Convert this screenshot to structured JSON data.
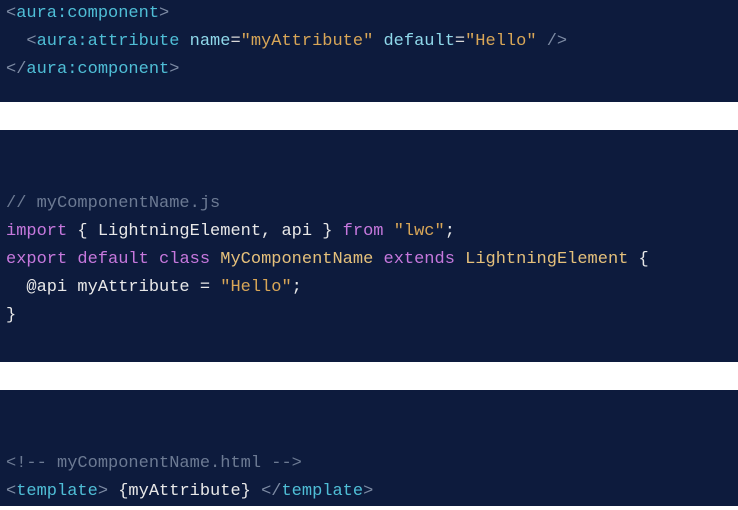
{
  "block1": {
    "l1_open": "<",
    "l1_tag": "aura:component",
    "l1_close": ">",
    "l2_indent": "  ",
    "l2_open": "<",
    "l2_tag": "aura:attribute",
    "l2_sp1": " ",
    "l2_attr1": "name",
    "l2_eq1": "=",
    "l2_val1": "\"myAttribute\"",
    "l2_sp2": " ",
    "l2_attr2": "default",
    "l2_eq2": "=",
    "l2_val2": "\"Hello\"",
    "l2_close": " />",
    "l3_open": "</",
    "l3_tag": "aura:component",
    "l3_close": ">"
  },
  "block2": {
    "l1": "// myComponentName.js",
    "l2_import": "import",
    "l2_rest1": " { LightningElement, api } ",
    "l2_from": "from",
    "l2_sp": " ",
    "l2_str": "\"lwc\"",
    "l2_semi": ";",
    "l3_export": "export",
    "l3_sp1": " ",
    "l3_default": "default",
    "l3_sp2": " ",
    "l3_class": "class",
    "l3_sp3": " ",
    "l3_name": "MyComponentName",
    "l3_sp4": " ",
    "l3_extends": "extends",
    "l3_sp5": " ",
    "l3_super": "LightningElement",
    "l3_brace": " {",
    "l4_indent": "  ",
    "l4_dec": "@api myAttribute ",
    "l4_eq": "=",
    "l4_sp": " ",
    "l4_str": "\"Hello\"",
    "l4_semi": ";",
    "l5": "}"
  },
  "block3": {
    "l1_open": "<!--",
    "l1_text": " myComponentName.html ",
    "l1_close": "-->",
    "l2_open": "<",
    "l2_tag": "template",
    "l2_close": ">",
    "l2_content": " {myAttribute} ",
    "l2_open2": "</",
    "l2_tag2": "template",
    "l2_close2": ">"
  }
}
